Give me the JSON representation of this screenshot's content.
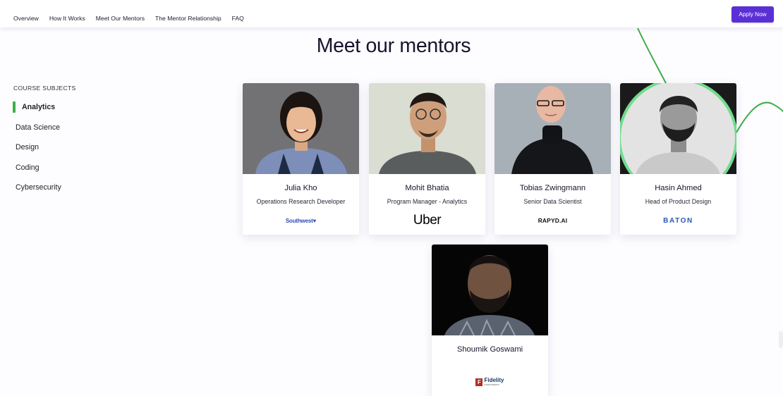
{
  "nav": {
    "links": [
      "Overview",
      "How It Works",
      "Meet Our Mentors",
      "The Mentor Relationship",
      "FAQ"
    ],
    "apply_label": "Apply Now"
  },
  "heading": "Meet our mentors",
  "sidebar": {
    "heading": "COURSE SUBJECTS",
    "items": [
      {
        "label": "Analytics",
        "active": true
      },
      {
        "label": "Data Science",
        "active": false
      },
      {
        "label": "Design",
        "active": false
      },
      {
        "label": "Coding",
        "active": false
      },
      {
        "label": "Cybersecurity",
        "active": false
      }
    ]
  },
  "mentors": [
    {
      "name": "Julia Kho",
      "role": "Operations Research Developer",
      "company_logo": "Southwest"
    },
    {
      "name": "Mohit Bhatia",
      "role": "Program Manager - Analytics",
      "company_logo": "Uber"
    },
    {
      "name": "Tobias Zwingmann",
      "role": "Senior Data Scientist",
      "company_logo": "RAPYD.AI"
    },
    {
      "name": "Hasin Ahmed",
      "role": "Head of Product Design",
      "company_logo": "BATON"
    },
    {
      "name": "Shoumik Goswami",
      "role": "",
      "company_logo": "Fidelity",
      "company_logo_sub": "INVESTMENTS"
    }
  ],
  "colors": {
    "accent": "#5b2fd6",
    "active_indicator": "#3fae49",
    "deco_curve": "#3fae49",
    "highlight_ring": "#6fdc8c"
  }
}
